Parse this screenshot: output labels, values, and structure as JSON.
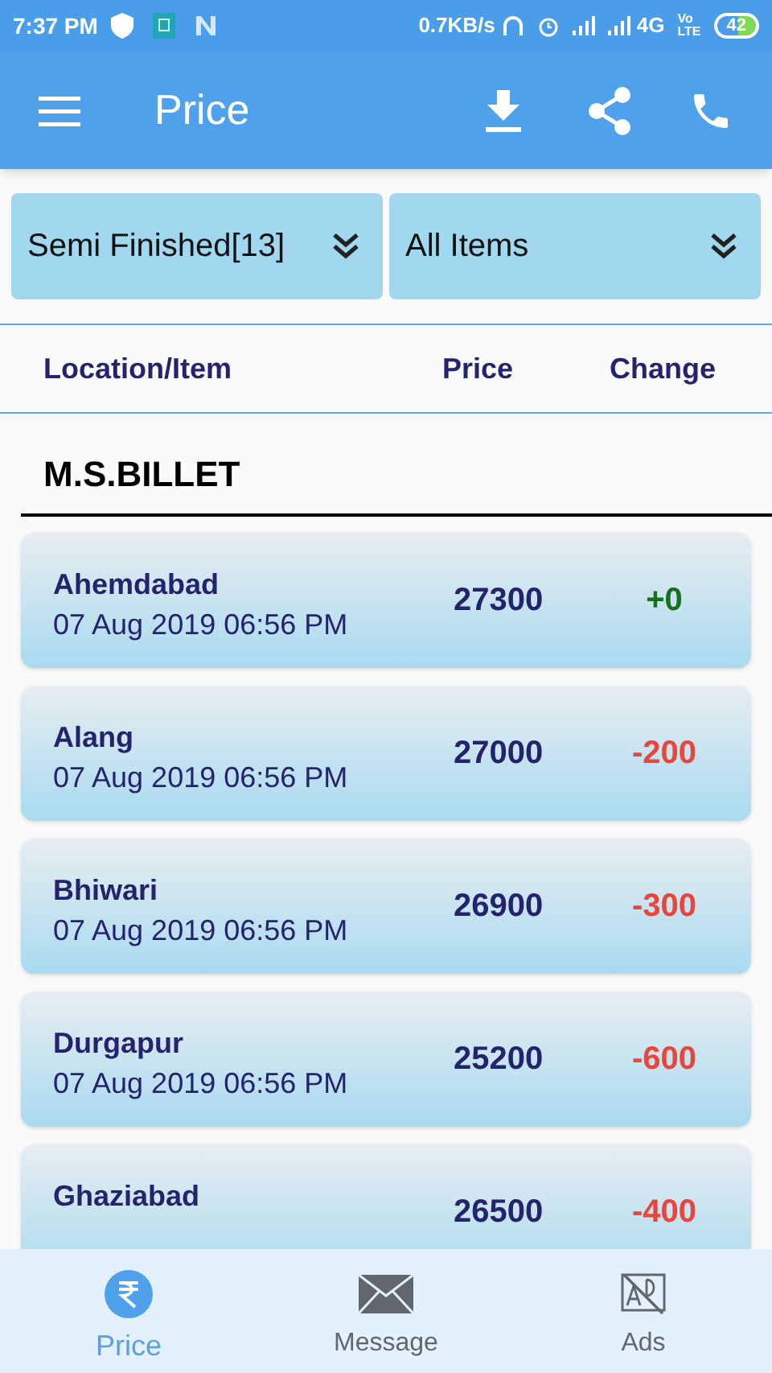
{
  "status_bar": {
    "time": "7:37 PM",
    "speed": "0.7KB/s",
    "network": "4G",
    "volte_top": "Vo",
    "volte_bottom": "LTE",
    "battery": "42"
  },
  "app_bar": {
    "title": "Price"
  },
  "filters": [
    {
      "value": "Semi Finished[13]"
    },
    {
      "value": "All Items"
    }
  ],
  "table": {
    "columns": [
      "Location/Item",
      "Price",
      "Change"
    ],
    "group": "M.S.BILLET",
    "rows": [
      {
        "location": "Ahemdabad",
        "date": "07 Aug 2019 06:56 PM",
        "price": "27300",
        "change": "+0",
        "color": "#1b6e1f"
      },
      {
        "location": "Alang",
        "date": "07 Aug 2019 06:56 PM",
        "price": "27000",
        "change": "-200",
        "color": "#e8453c"
      },
      {
        "location": "Bhiwari",
        "date": "07 Aug 2019 06:56 PM",
        "price": "26900",
        "change": "-300",
        "color": "#e8453c"
      },
      {
        "location": "Durgapur",
        "date": "07 Aug 2019 06:56 PM",
        "price": "25200",
        "change": "-600",
        "color": "#e8453c"
      },
      {
        "location": "Ghaziabad",
        "price": "26500",
        "change": "-400",
        "color": "#e8453c"
      }
    ]
  },
  "bottom_nav": [
    {
      "kind": "rupee",
      "label": "Price",
      "selected": true
    },
    {
      "kind": "mail",
      "label": "Message",
      "selected": false
    },
    {
      "kind": "ads",
      "label": "Ads",
      "selected": false
    }
  ]
}
